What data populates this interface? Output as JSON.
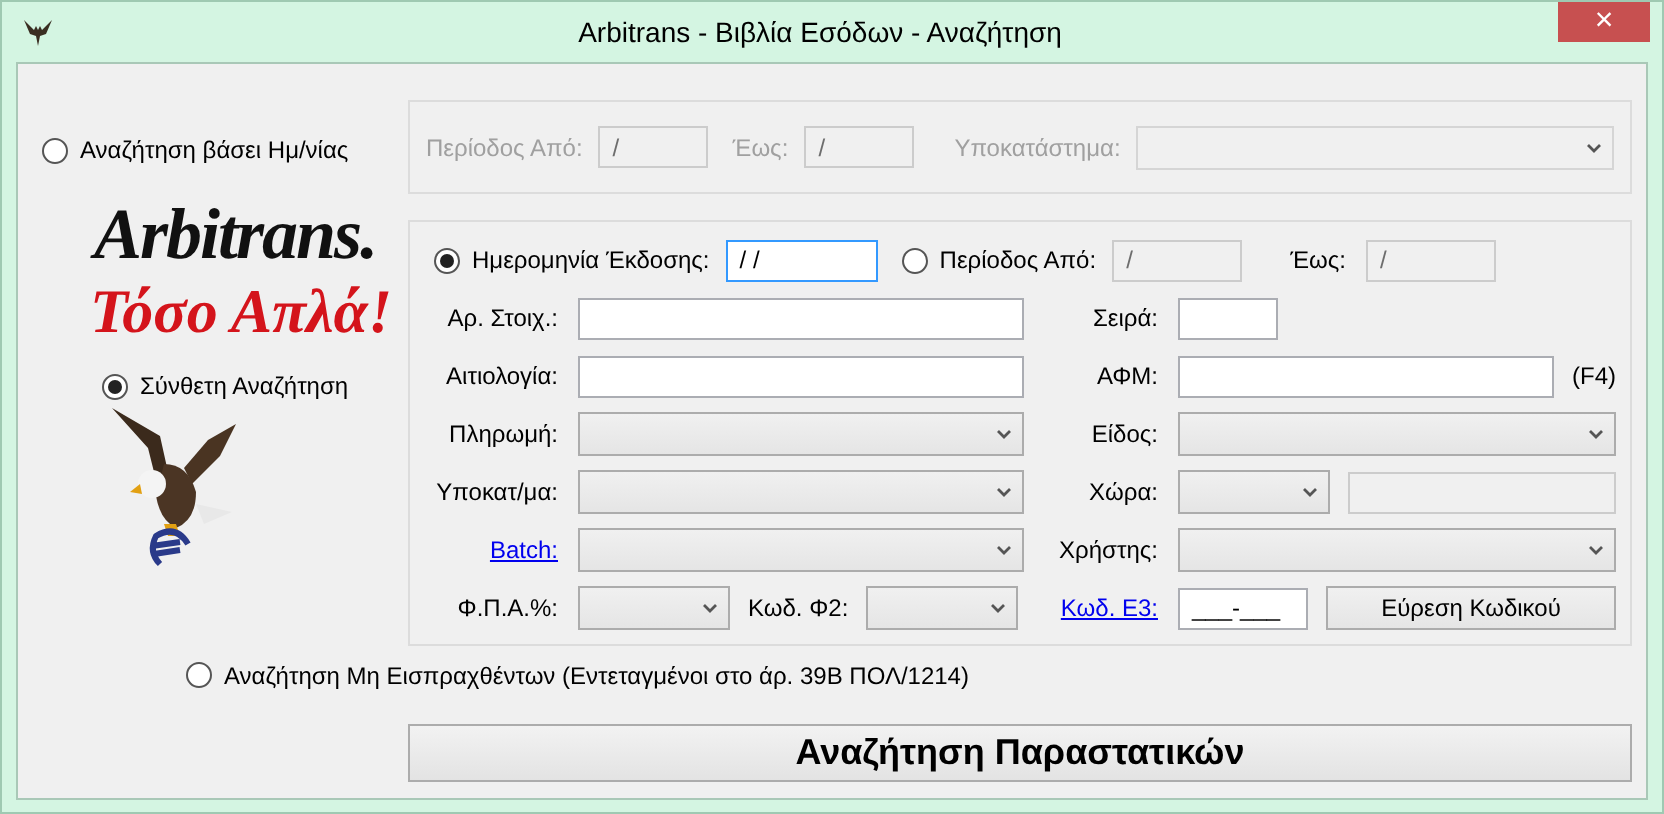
{
  "window": {
    "title": "Arbitrans - Βιβλία Εσόδων - Αναζήτηση",
    "close": "×"
  },
  "date_mode": {
    "label": "Αναζήτηση βάσει Ημ/νίας",
    "selected": false
  },
  "date_search": {
    "disabled": true,
    "from_label": "Περίοδος Από:",
    "from_value": "/",
    "to_label": "Έως:",
    "to_value": "/",
    "branch_label": "Υποκατάστημα:"
  },
  "logo": {
    "name": "Arbitrans.",
    "slogan": "Τόσο Απλά!"
  },
  "compound_mode": {
    "label": "Σύνθετη Αναζήτηση",
    "selected": true
  },
  "compound_search": {
    "date_options": [
      {
        "label": "Ημερομηνία Έκδοσης:",
        "selected": true,
        "value": "/ /",
        "focused": true,
        "disabled": false
      },
      {
        "label": "Περίοδος Από:",
        "selected": false,
        "value": "/",
        "focused": false,
        "disabled": true
      }
    ],
    "to_label": "Έως:",
    "to_value": "/",
    "to_disabled": true,
    "rows": [
      [
        {
          "label": "Αρ. Στοιχ.:",
          "link": false,
          "controls": [
            {
              "kind": "input",
              "disabled": false
            }
          ]
        },
        {
          "label": "Σειρά:",
          "link": false,
          "controls": [
            {
              "kind": "input-short",
              "disabled": false
            }
          ]
        }
      ],
      [
        {
          "label": "Αιτιολογία:",
          "link": false,
          "controls": [
            {
              "kind": "input",
              "disabled": false
            }
          ]
        },
        {
          "label": "ΑΦΜ:",
          "link": false,
          "controls": [
            {
              "kind": "input",
              "disabled": false
            },
            {
              "kind": "hint",
              "text": "(F4)"
            }
          ]
        }
      ],
      [
        {
          "label": "Πληρωμή:",
          "link": false,
          "controls": [
            {
              "kind": "select"
            }
          ]
        },
        {
          "label": "Είδος:",
          "link": false,
          "controls": [
            {
              "kind": "select"
            }
          ]
        }
      ],
      [
        {
          "label": "Υποκατ/μα:",
          "link": false,
          "controls": [
            {
              "kind": "select"
            }
          ]
        },
        {
          "label": "Χώρα:",
          "link": false,
          "controls": [
            {
              "kind": "select-small"
            },
            {
              "kind": "input",
              "disabled": true
            }
          ]
        }
      ],
      [
        {
          "label": "Batch:",
          "link": true,
          "controls": [
            {
              "kind": "select"
            }
          ]
        },
        {
          "label": "Χρήστης:",
          "link": false,
          "controls": [
            {
              "kind": "select"
            }
          ]
        }
      ],
      [
        {
          "label": "Φ.Π.Α.%:",
          "link": false,
          "controls": [
            {
              "kind": "select-small"
            },
            {
              "kind": "text",
              "text": "Κωδ. Φ2:"
            },
            {
              "kind": "select-small"
            }
          ]
        },
        {
          "label": "Κωδ. Ε3:",
          "link": true,
          "controls": [
            {
              "kind": "input-small",
              "value": "___-___",
              "disabled": false
            },
            {
              "kind": "button",
              "text": "Εύρεση Κωδικού"
            }
          ]
        }
      ]
    ]
  },
  "unpaid_mode": {
    "label": "Αναζήτηση Μη Εισπραχθέντων (Εντεταγμένοι στο άρ. 39Β ΠΟΛ/1214)",
    "selected": false
  },
  "search_button": "Αναζήτηση Παραστατικών"
}
